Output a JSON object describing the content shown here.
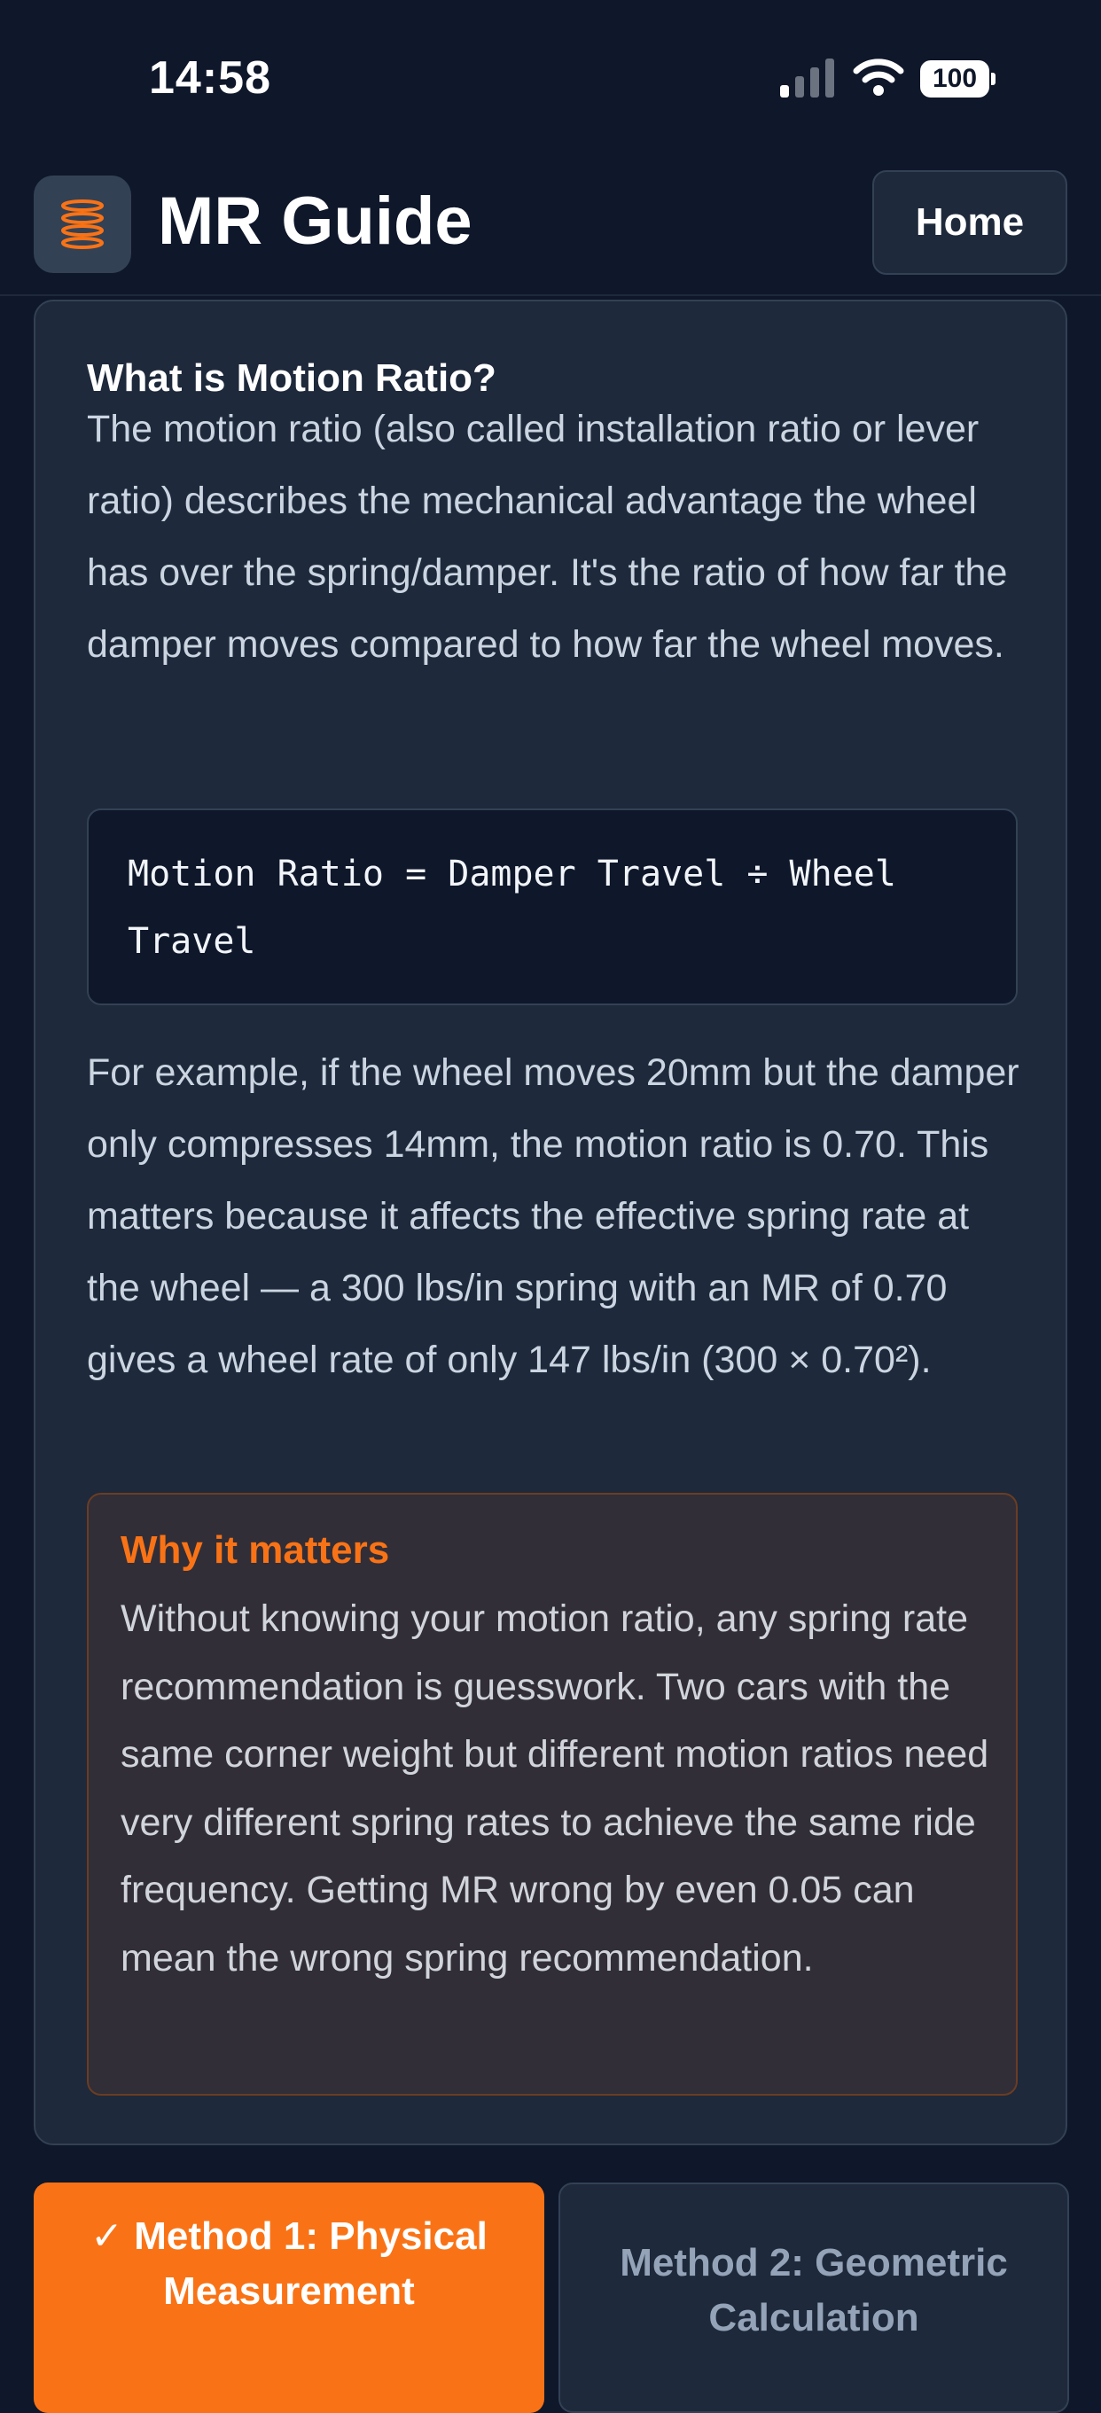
{
  "status_bar": {
    "time": "14:58",
    "battery": "100"
  },
  "header": {
    "title": "MR Guide",
    "home_button": "Home",
    "logo_icon": "spring-coil-icon"
  },
  "info_card": {
    "heading": "What is Motion Ratio?",
    "intro": "The motion ratio (also called installation ratio or lever ratio) describes the mechanical advantage the wheel has over the spring/damper. It's the ratio of how far the damper moves compared to how far the wheel moves.",
    "formula": "Motion Ratio = Damper Travel ÷ Wheel Travel",
    "example": "For example, if the wheel moves 20mm but the damper only compresses 14mm, the motion ratio is 0.70. This matters because it affects the effective spring rate at the wheel — a 300 lbs/in spring with an MR of 0.70 gives a wheel rate of only 147 lbs/in (300 × 0.70²).",
    "callout": {
      "title": "Why it matters",
      "text": "Without knowing your motion ratio, any spring rate recommendation is guesswork. Two cars with the same corner weight but different motion ratios need very different spring rates to achieve the same ride frequency. Getting MR wrong by even 0.05 can mean the wrong spring recommendation."
    }
  },
  "method_tabs": [
    {
      "label": "✓ Method 1: Physical Measurement",
      "selected": true
    },
    {
      "label": "Method 2: Geometric Calculation",
      "selected": false
    }
  ],
  "colors": {
    "accent": "#f97316",
    "background": "#0f172a",
    "card": "#1e293b"
  }
}
